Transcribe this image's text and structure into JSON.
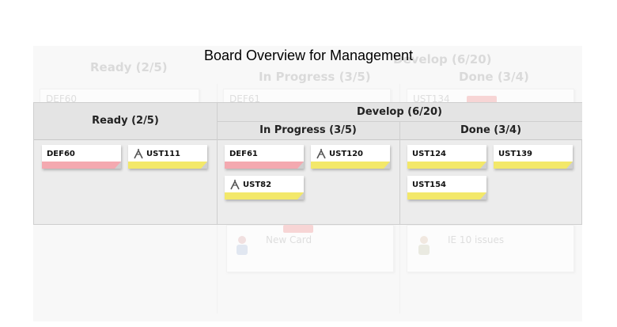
{
  "page_title": "Board Overview for Management",
  "ghost": {
    "ready": "Ready (2/5)",
    "develop": "Develop (6/20)",
    "in_progress": "In Progress (3/5)",
    "done": "Done (3/4)",
    "card_def60": "DEF60",
    "card_def61": "DEF61",
    "card_ust134": "UST134",
    "new_card": "New Card",
    "ie_issues": "IE 10 issues"
  },
  "board": {
    "ready_header": "Ready (2/5)",
    "develop_header": "Develop (6/20)",
    "in_progress_header": "In Progress (3/5)",
    "done_header": "Done (3/4)",
    "cards": {
      "def60": "DEF60",
      "ust111": "UST111",
      "def61": "DEF61",
      "ust120": "UST120",
      "ust82": "UST82",
      "ust124": "UST124",
      "ust139": "UST139",
      "ust154": "UST154"
    }
  },
  "colors": {
    "defect_bar": "#f4a9b0",
    "story_bar": "#f3e86a",
    "header_bg": "#e4e4e4",
    "board_bg": "#ececec"
  },
  "icons": {
    "story": "branch-icon"
  }
}
